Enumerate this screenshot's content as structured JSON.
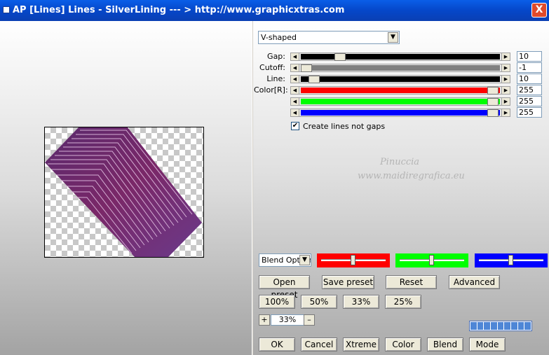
{
  "window": {
    "title": "AP [Lines]  Lines - SilverLining     --- > http://www.graphicxtras.com",
    "close_label": "X"
  },
  "mode_dropdown": {
    "selected": "V-shaped"
  },
  "sliders": [
    {
      "label": "Gap:",
      "value": "10",
      "color": "#000000",
      "thumb_fraction": 0.18
    },
    {
      "label": "Cutoff:",
      "value": "-1",
      "color": "#808080",
      "thumb_fraction": 0.0
    },
    {
      "label": "Line:",
      "value": "10",
      "color": "#000000",
      "thumb_fraction": 0.04
    },
    {
      "label": "Color[R]:",
      "value": "255",
      "color": "#ff0000",
      "thumb_fraction": 1.0
    },
    {
      "label": "",
      "value": "255",
      "color": "#00ff00",
      "thumb_fraction": 1.0
    },
    {
      "label": "",
      "value": "255",
      "color": "#0000ff",
      "thumb_fraction": 1.0
    }
  ],
  "checkbox": {
    "label": "Create lines not gaps",
    "checked": true
  },
  "watermark": {
    "line1": "Pinuccia",
    "line2": "www.maidiregrafica.eu"
  },
  "blend_select": {
    "selected": "Blend Options"
  },
  "color_sliders": [
    {
      "color": "#ff0000",
      "thumb_fraction": 0.5
    },
    {
      "color": "#00ff00",
      "thumb_fraction": 0.5
    },
    {
      "color": "#0000ff",
      "thumb_fraction": 0.5
    }
  ],
  "buttons": {
    "open_preset": "Open preset",
    "save_preset": "Save preset",
    "reset": "Reset",
    "advanced": "Advanced",
    "zoom100": "100%",
    "zoom50": "50%",
    "zoom33": "33%",
    "zoom25": "25%",
    "ok": "OK",
    "cancel": "Cancel",
    "xtreme": "Xtreme",
    "color": "Color",
    "blend": "Blend",
    "mode": "Mode"
  },
  "zoom": {
    "value": "33%",
    "plus": "+",
    "minus": "–"
  },
  "icons": {
    "dropdown_arrow": "chevron-down-icon",
    "check": "check-icon"
  },
  "progress": {
    "segments": 9
  }
}
